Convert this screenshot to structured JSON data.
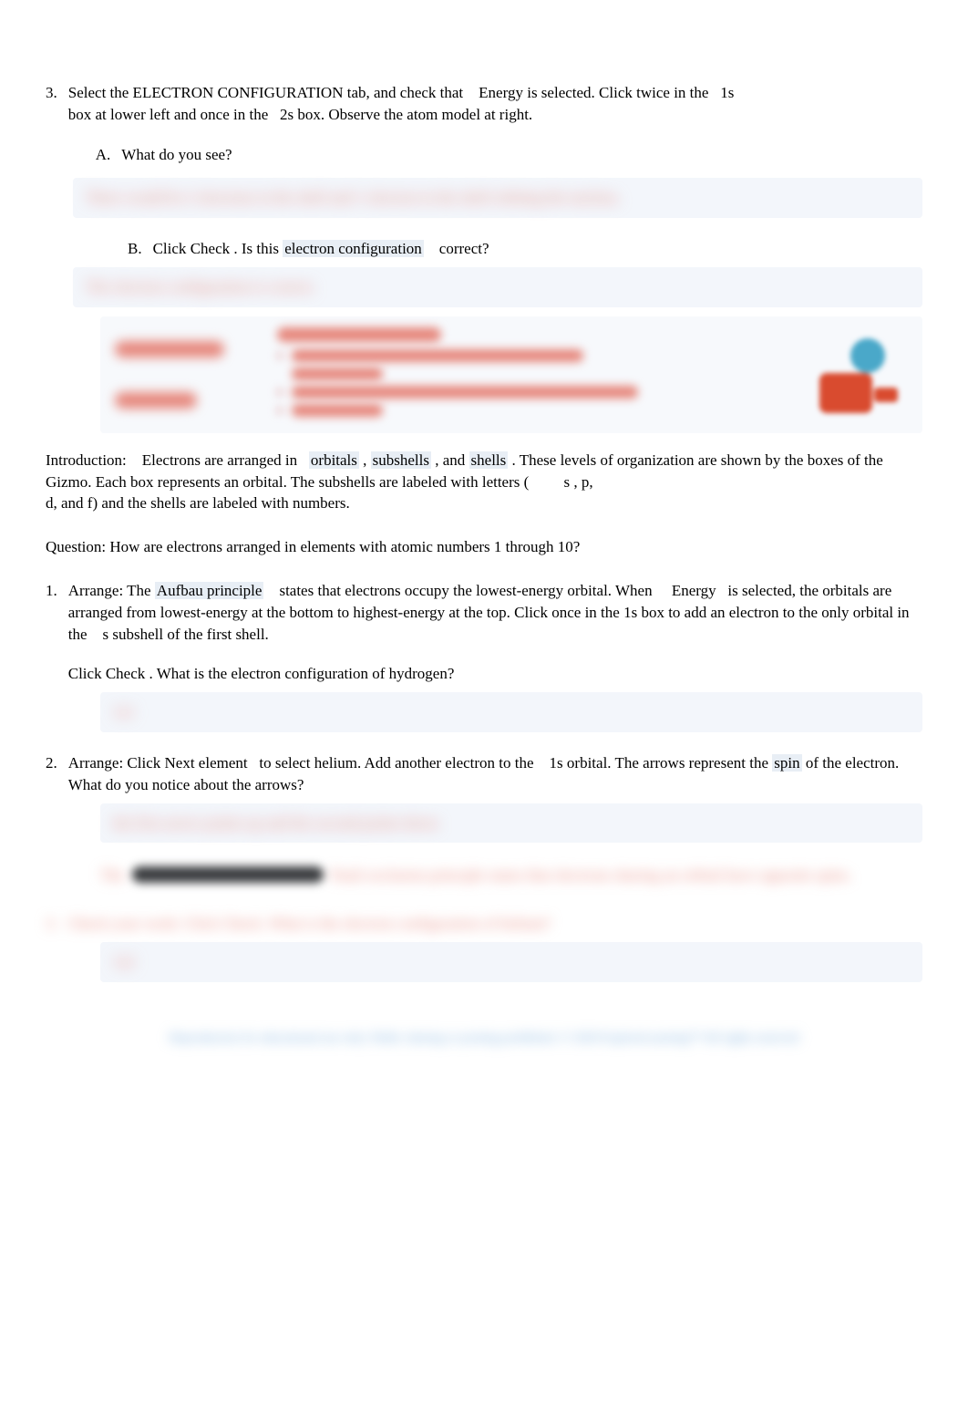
{
  "q3": {
    "num": "3.",
    "prompt_parts": {
      "p1": "Select the ELECTRON CONFIGURATION tab, and check that ",
      "energy": "Energy",
      "p2": " is selected. Click twice in the ",
      "one_s": "1s",
      "p3": "box at lower left and once in the ",
      "two_s": "2s",
      "p4": " box. Observe the atom model at right."
    },
    "A": {
      "letter": "A.",
      "text": "What do you see?"
    },
    "answerA_hidden": "There would be 2 electrons in the shell and 1 electron in the shell orbiting the nucleus.",
    "B": {
      "letter": "B.",
      "p1": "Click ",
      "check": "Check",
      "p2": " . Is this ",
      "econf": "electron configuration",
      "p3": " correct?"
    },
    "answerB_hidden": "The electron configuration is correct.",
    "card": {
      "left_a": "Activity B:",
      "left_b": "Small orbitals",
      "title": "Get the Gizmo ready:",
      "b1": "On the PERIODIC TABLE tab, select H",
      "b1b": "(hydrogen).",
      "b2": "Select the ELECTRON CONFIGURATION tab.",
      "b3": "Click Reset."
    }
  },
  "intro": {
    "label": "Introduction:",
    "p1": " Electrons are arranged in ",
    "orbitals": "orbitals",
    "c1": " , ",
    "subshells": "subshells",
    "c2": " , and ",
    "shells": "shells",
    "p2": " . These levels of organization are shown by the boxes of the Gizmo. Each box represents an orbital. The subshells are labeled with letters ( ",
    "s": "s",
    "comma_sp": " , ",
    "p": "p",
    "p3": "d, and  f) and the shells are labeled with numbers."
  },
  "question_line": "Question: How are electrons arranged in elements with atomic numbers 1 through 10?",
  "q1": {
    "num": "1.",
    "p1": "Arrange: The ",
    "aufbau": "Aufbau principle",
    "p2": " states that electrons occupy the lowest-energy orbital. When ",
    "energy": "Energy",
    "p3": " is selected, the orbitals are arranged from lowest-energy at the bottom to highest-energy at the top. Click once in the  ",
    "one_s": "1s",
    "p4": " box to add an electron to the only orbital in the ",
    "s": "s",
    "p5": " subshell of the first shell.",
    "check_line_a": "Click ",
    "check": "Check",
    "check_line_b": " . What is the electron configuration of hydrogen?",
    "ans_hidden": "1s1"
  },
  "q2": {
    "num": "2.",
    "p1": "Arrange: Click ",
    "nextel": "Next element",
    "p2": " to select helium. Add another electron to the ",
    "one_s": "1s",
    "p3": " orbital. The arrows represent the ",
    "spin": "spin",
    "p4": " of the electron. What do you notice about the arrows?",
    "ansA_hidden": "the first arrow points up and the second points down",
    "pauli_pre": "The ",
    "pauli_post": " states that electrons sharing an orbital have opposite spins.",
    "pauli_tail_hidden": "Pauli exclusion principle states that electrons sharing an orbital have opposite spins."
  },
  "q3b": {
    "num": "3.",
    "line_hidden": "Check your work: Click Check. What is the electron configuration of helium?",
    "ans_hidden": "1s2"
  },
  "footer_hidden": "Reproduction for educational use only. Public sharing or posting prohibited. © 2020 ExploreLearning™ All rights reserved"
}
